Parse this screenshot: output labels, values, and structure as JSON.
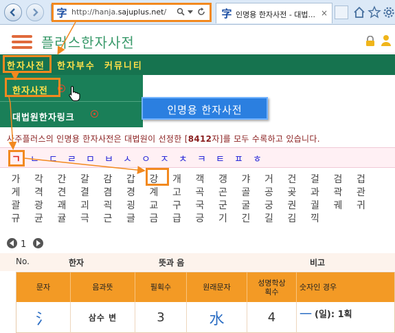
{
  "browser": {
    "url_prefix": "http://hanja.",
    "url_domain": "sajuplus.net",
    "url_suffix": "/",
    "favicon_glyph": "字",
    "tab_title": "인명용 한자사전 - 대법...",
    "tab_close": "×"
  },
  "site": {
    "logo": "플러스한자사전"
  },
  "nav": {
    "items": [
      "한자사전",
      "한자부수",
      "커뮤니티"
    ]
  },
  "dropdown": {
    "items": [
      "한자사전",
      "대법원한자링크"
    ]
  },
  "banner": "인명용 한자사전",
  "intro": {
    "text_before": "사주플러스의 인명용 한자사전은 대법원이 선정한 [",
    "count": "8412",
    "text_after": "자]를 모두 수록하고 있습니다."
  },
  "consonants": [
    "ㄱ",
    "ㄴ",
    "ㄷ",
    "ㄹ",
    "ㅁ",
    "ㅂ",
    "ㅅ",
    "ㅇ",
    "ㅈ",
    "ㅊ",
    "ㅋ",
    "ㅌ",
    "ㅍ",
    "ㅎ"
  ],
  "syllables": [
    [
      "가",
      "각",
      "간",
      "갈",
      "감",
      "갑",
      "강",
      "개",
      "객",
      "갱",
      "갸",
      "거",
      "건",
      "걸",
      "검",
      "겁"
    ],
    [
      "게",
      "격",
      "견",
      "결",
      "겸",
      "경",
      "계",
      "고",
      "곡",
      "곤",
      "골",
      "공",
      "곶",
      "과",
      "곽",
      "관"
    ],
    [
      "괄",
      "광",
      "괘",
      "괴",
      "괵",
      "굉",
      "교",
      "구",
      "국",
      "군",
      "굴",
      "궁",
      "권",
      "궐",
      "궤",
      "귀"
    ],
    [
      "규",
      "균",
      "귤",
      "극",
      "근",
      "글",
      "금",
      "급",
      "긍",
      "기",
      "긴",
      "길",
      "김",
      "끽"
    ]
  ],
  "pager": {
    "page": "1"
  },
  "table": {
    "headers": [
      "No.",
      "한자",
      "뜻과 음",
      "비고"
    ],
    "detail_headers": [
      "문자",
      "음과뜻",
      "필획수",
      "원래문자",
      "성명학상\n획수",
      "숫자인 경우"
    ],
    "row": {
      "char": "氵",
      "reading": "삼수 변",
      "strokes": "3",
      "original": "水",
      "name_strokes": "4",
      "number_char": "一",
      "number_text": "(일): 1획"
    }
  },
  "colors": {
    "nav_green": "#16734f",
    "highlight_orange": "#f2891f",
    "link_blue": "#2b2bd9",
    "active_red": "#e0261e",
    "table_header_orange": "#f39a25"
  }
}
